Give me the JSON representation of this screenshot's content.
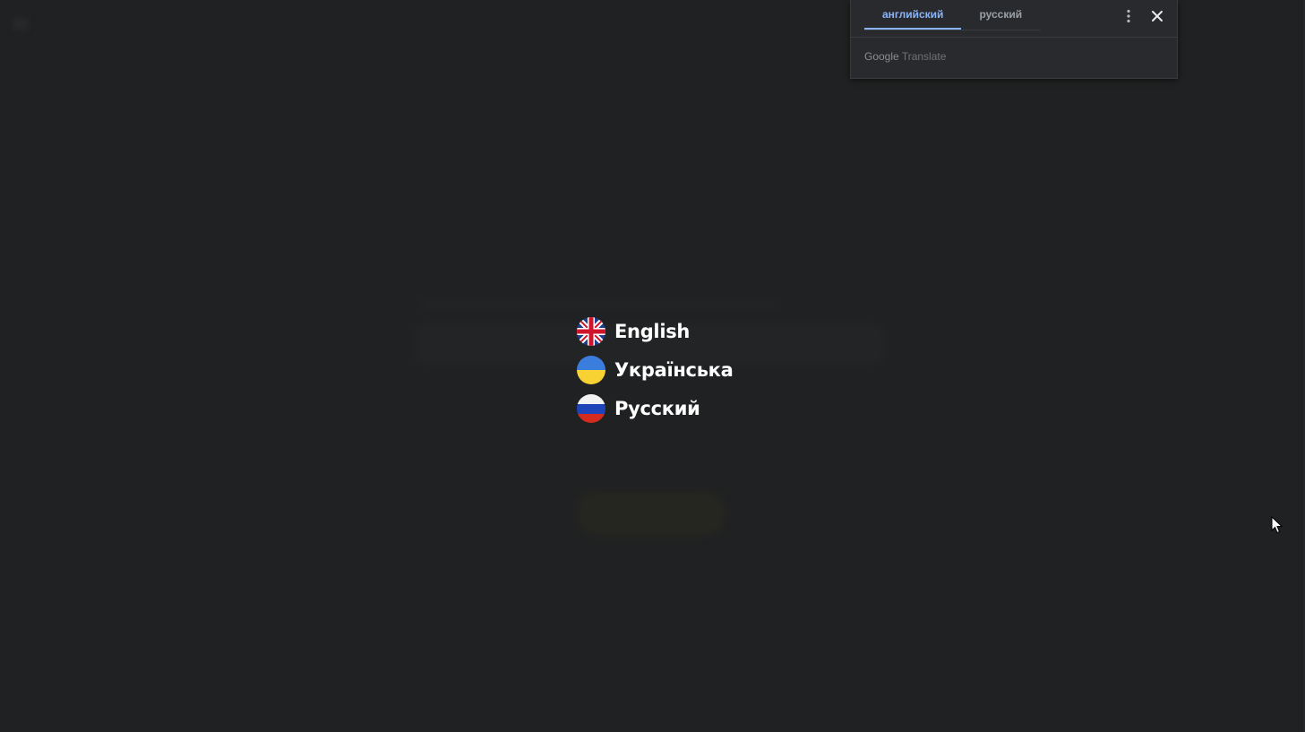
{
  "translate_popup": {
    "tabs": [
      {
        "label": "английский",
        "active": true
      },
      {
        "label": "русский",
        "active": false
      }
    ],
    "footer_brand": "Google",
    "footer_product": "Translate",
    "menu_icon": "more-vert-icon",
    "close_icon": "close-icon"
  },
  "languages": [
    {
      "label": "English",
      "flag": "uk-flag-icon"
    },
    {
      "label": "Українська",
      "flag": "ukraine-flag-icon"
    },
    {
      "label": "Русский",
      "flag": "russia-flag-icon"
    }
  ],
  "colors": {
    "background": "#1f2122",
    "accent": "#8ab4f8",
    "popup_background": "#292a2d"
  }
}
